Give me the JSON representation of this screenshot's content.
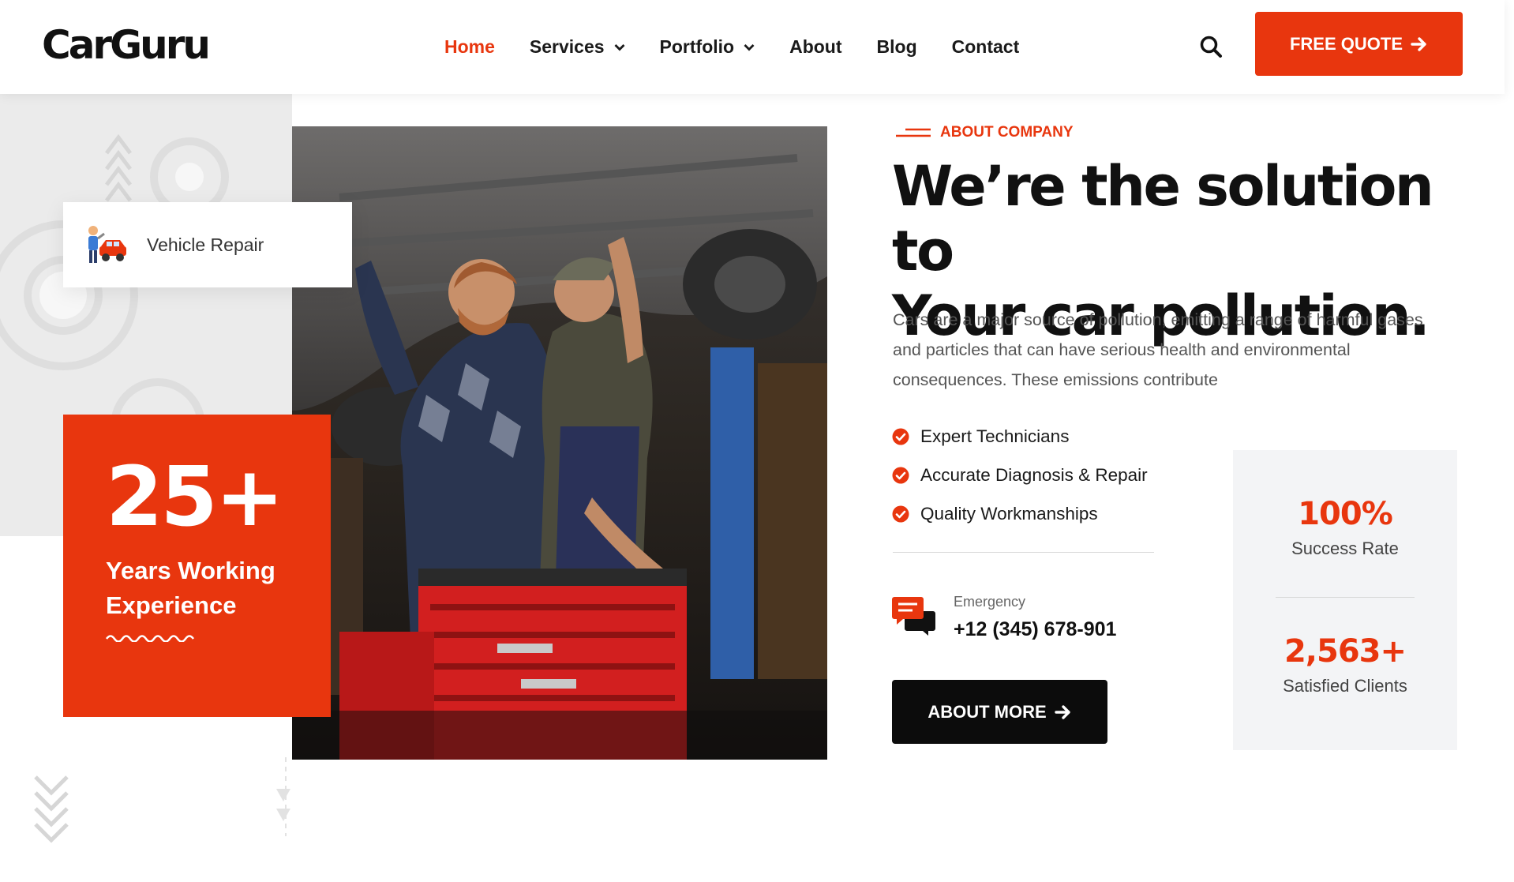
{
  "brand": {
    "name": "CarGuru",
    "accent": "#e8360e",
    "dark": "#0c0c0c"
  },
  "nav": {
    "items": [
      {
        "label": "Home",
        "active": true,
        "dropdown": false
      },
      {
        "label": "Services",
        "active": false,
        "dropdown": true
      },
      {
        "label": "Portfolio",
        "active": false,
        "dropdown": true
      },
      {
        "label": "About",
        "active": false,
        "dropdown": false
      },
      {
        "label": "Blog",
        "active": false,
        "dropdown": false
      },
      {
        "label": "Contact",
        "active": false,
        "dropdown": false
      }
    ],
    "search_icon": "search-icon",
    "cta_label": "FREE QUOTE",
    "cta_icon": "arrow-right-icon"
  },
  "hero": {
    "image_subject": "two mechanics working under a lifted car with a red tool chest",
    "repair_card": {
      "label": "Vehicle Repair",
      "icon": "mechanic-car-icon"
    },
    "experience": {
      "number": "25+",
      "label": "Years Working Experience"
    }
  },
  "about": {
    "eyebrow": "ABOUT COMPANY",
    "headline_line1": "We’re the solution to",
    "headline_line2": "Your car pollution.",
    "description": "Cars are a major source of pollution, emitting a range of harmful gases and particles that can have serious health and environmental consequences. These emissions contribute",
    "features": [
      "Expert Technicians",
      "Accurate Diagnosis & Repair",
      "Quality Workmanships"
    ],
    "emergency": {
      "label": "Emergency",
      "phone": "+12 (345) 678-901",
      "icon": "chat-bubbles-icon"
    },
    "button_label": "ABOUT MORE"
  },
  "stats": [
    {
      "value": "100%",
      "label": "Success Rate"
    },
    {
      "value": "2,563+",
      "label": "Satisfied Clients"
    }
  ]
}
